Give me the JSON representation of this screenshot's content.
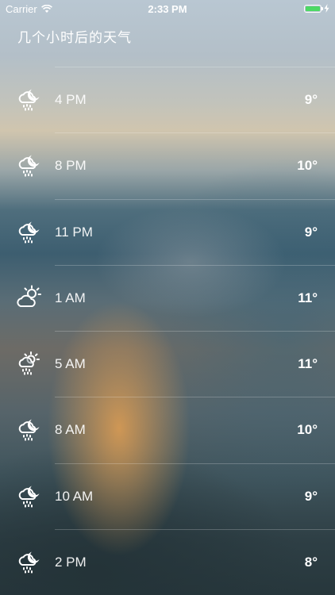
{
  "status_bar": {
    "carrier": "Carrier",
    "time": "2:33 PM",
    "battery_level": 1.0,
    "battery_color": "#4cd964"
  },
  "screen": {
    "title": "几个小时后的天气"
  },
  "hours": [
    {
      "time": "4 PM",
      "temp": "9°",
      "icon": "cloud-rain-moon-icon"
    },
    {
      "time": "8 PM",
      "temp": "10°",
      "icon": "cloud-rain-moon-icon"
    },
    {
      "time": "11 PM",
      "temp": "9°",
      "icon": "cloud-rain-moon-icon"
    },
    {
      "time": "1 AM",
      "temp": "11°",
      "icon": "partly-cloudy-sun-icon"
    },
    {
      "time": "5 AM",
      "temp": "11°",
      "icon": "sun-rain-icon"
    },
    {
      "time": "8 AM",
      "temp": "10°",
      "icon": "cloud-rain-moon-icon"
    },
    {
      "time": "10 AM",
      "temp": "9°",
      "icon": "cloud-rain-moon-icon"
    },
    {
      "time": "2 PM",
      "temp": "8°",
      "icon": "cloud-rain-moon-icon"
    }
  ]
}
